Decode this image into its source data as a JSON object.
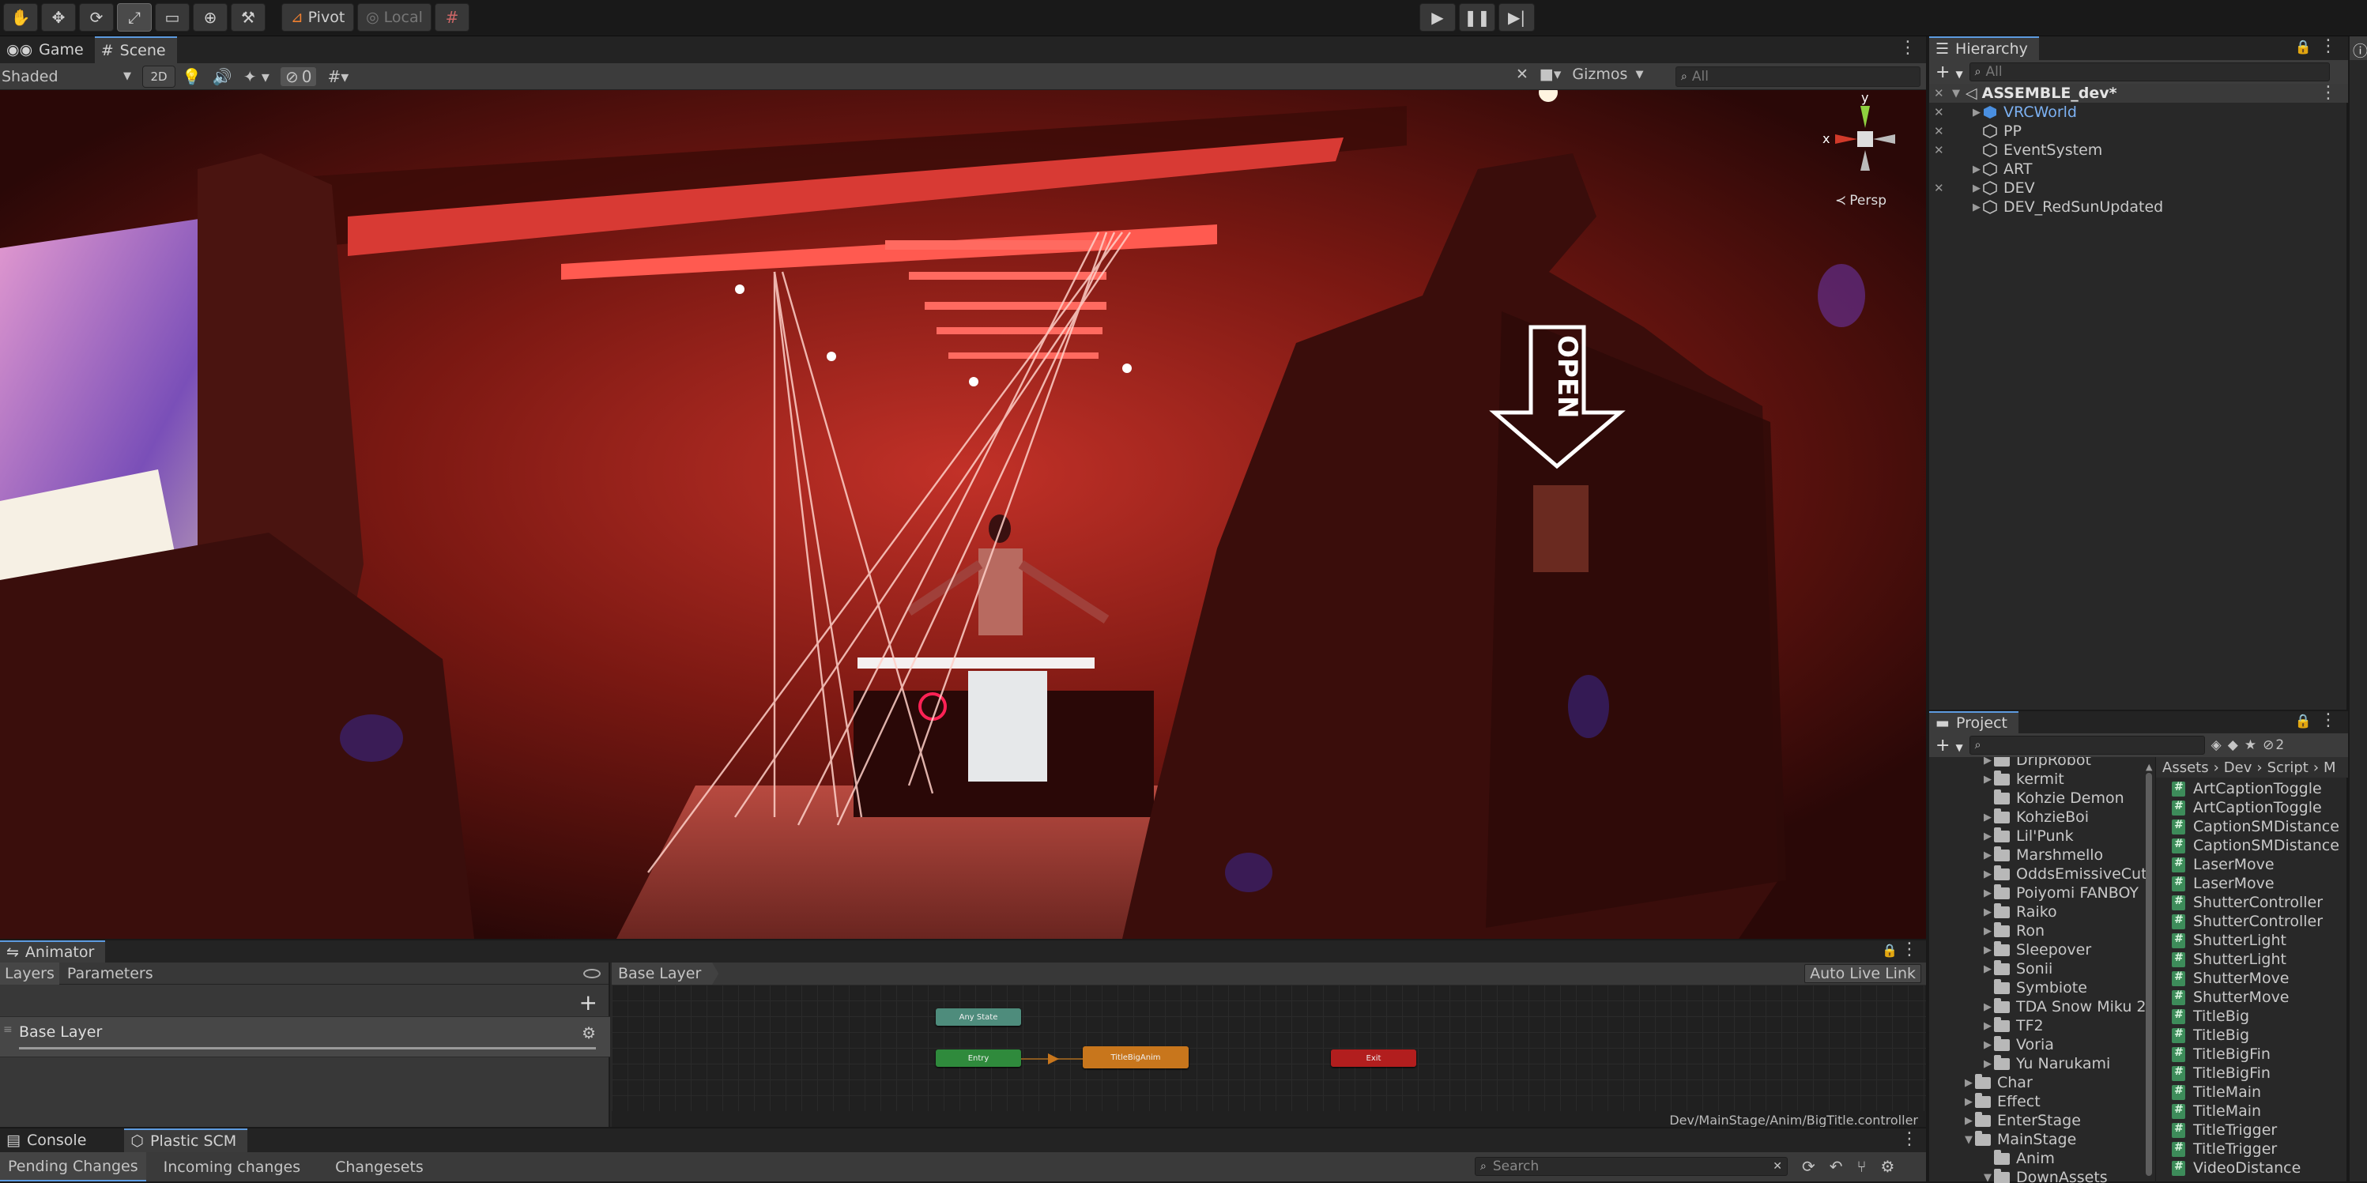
{
  "toolbar": {
    "pivot_label": "Pivot",
    "local_label": "Local"
  },
  "scene_view": {
    "tabs": [
      "Game",
      "Scene"
    ],
    "shading_mode": "Shaded",
    "mode_2d": "2D",
    "hidden_count": "0",
    "gizmos_label": "Gizmos",
    "search_placeholder": "All",
    "gizmo_axes": {
      "y": "y",
      "x": "x"
    },
    "perspective_label": "Persp",
    "sign_text": "OPEN"
  },
  "hierarchy": {
    "title": "Hierarchy",
    "search_placeholder": "All",
    "root": "ASSEMBLE_dev*",
    "items": [
      {
        "label": "VRCWorld",
        "prefab": true
      },
      {
        "label": "PP",
        "prefab": false
      },
      {
        "label": "EventSystem",
        "prefab": false
      },
      {
        "label": "ART",
        "prefab": false
      },
      {
        "label": "DEV",
        "prefab": false
      },
      {
        "label": "DEV_RedSunUpdated",
        "prefab": false
      }
    ]
  },
  "project": {
    "title": "Project",
    "hidden_count": "2",
    "breadcrumb": [
      "Assets",
      "Dev",
      "Script",
      "M"
    ],
    "folders": [
      {
        "label": "DripRobot"
      },
      {
        "label": "kermit"
      },
      {
        "label": "Kohzie Demon"
      },
      {
        "label": "KohzieBoi"
      },
      {
        "label": "Lil'Punk"
      },
      {
        "label": "Marshmello"
      },
      {
        "label": "OddsEmissiveCut"
      },
      {
        "label": "Poiyomi FANBOY"
      },
      {
        "label": "Raiko"
      },
      {
        "label": "Ron"
      },
      {
        "label": "Sleepover"
      },
      {
        "label": "Sonii"
      },
      {
        "label": "Symbiote"
      },
      {
        "label": "TDA Snow Miku 2"
      },
      {
        "label": "TF2"
      },
      {
        "label": "Voria"
      },
      {
        "label": "Yu Narukami"
      },
      {
        "label": "Char"
      },
      {
        "label": "Effect"
      },
      {
        "label": "EnterStage"
      },
      {
        "label": "MainStage"
      },
      {
        "label": "Anim"
      },
      {
        "label": "DownAssets"
      }
    ],
    "files": [
      "ArtCaptionToggle",
      "ArtCaptionToggle",
      "CaptionSMDistance",
      "CaptionSMDistance",
      "LaserMove",
      "LaserMove",
      "ShutterController",
      "ShutterController",
      "ShutterLight",
      "ShutterLight",
      "ShutterMove",
      "ShutterMove",
      "TitleBig",
      "TitleBig",
      "TitleBigFin",
      "TitleBigFin",
      "TitleMain",
      "TitleMain",
      "TitleTrigger",
      "TitleTrigger",
      "VideoDistance"
    ]
  },
  "animator": {
    "title": "Animator",
    "tab_layers": "Layers",
    "tab_parameters": "Parameters",
    "layer_name": "Base Layer",
    "breadcrumb": "Base Layer",
    "auto_live_link": "Auto Live Link",
    "path": "Dev/MainStage/Anim/BigTitle.controller",
    "states": {
      "any_state": "Any State",
      "entry": "Entry",
      "default": "TitleBigAnim",
      "exit": "Exit"
    }
  },
  "console": {
    "tab_console": "Console",
    "tab_plastic": "Plastic SCM",
    "sub_tabs": [
      "Pending Changes",
      "Incoming changes",
      "Changesets"
    ],
    "search_placeholder": "Search"
  },
  "colors": {
    "accent": "#5d9be0",
    "prefab_text": "#7cb1f2",
    "any_state": "#4e8c7c",
    "entry": "#2f8a3c",
    "default_state": "#c8761c",
    "exit": "#b21e1e"
  }
}
